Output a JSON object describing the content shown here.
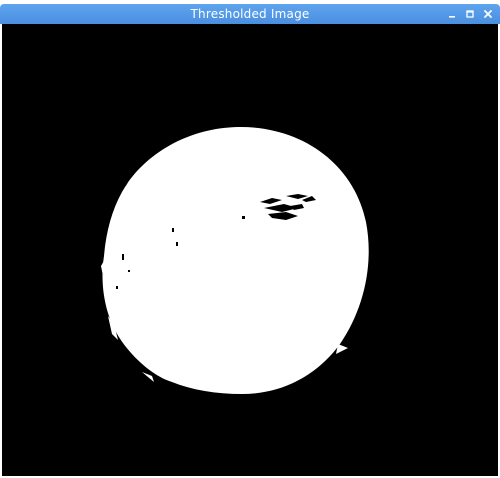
{
  "window": {
    "title": "Thresholded Image",
    "accent_color": "#4a8fe0",
    "controls": [
      {
        "name": "minimize",
        "icon": "minimize-icon"
      },
      {
        "name": "maximize",
        "icon": "maximize-icon"
      },
      {
        "name": "close",
        "icon": "close-icon"
      }
    ]
  },
  "image": {
    "description_type": "binary-threshold",
    "foreground_color": "#ffffff",
    "background_color": "#000000"
  }
}
